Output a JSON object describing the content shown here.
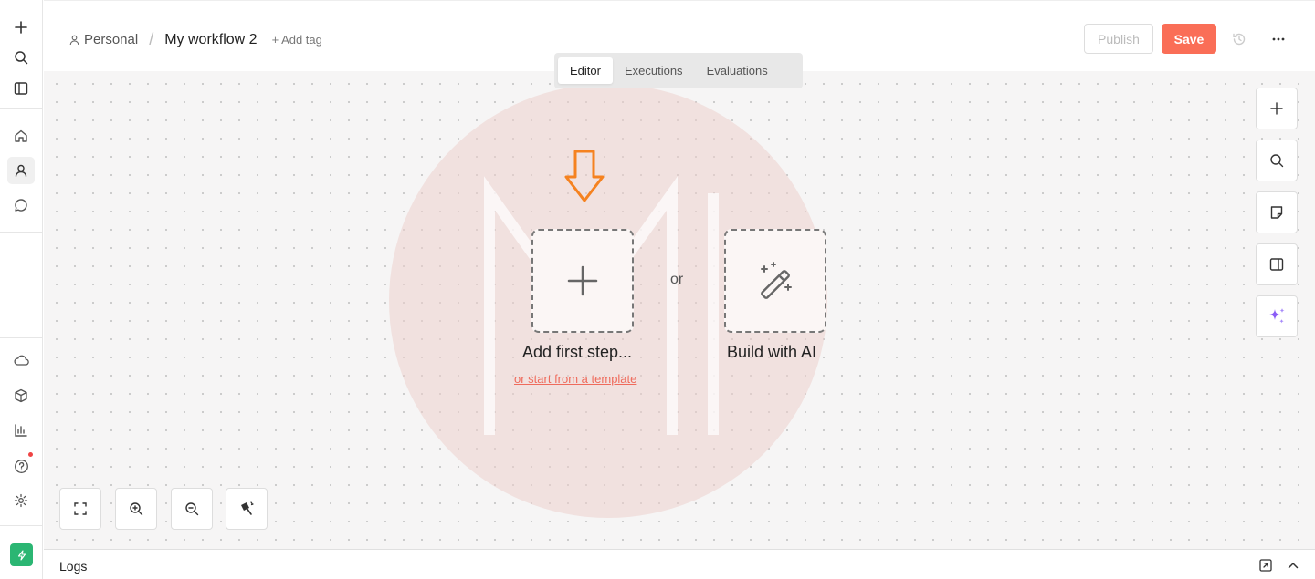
{
  "header": {
    "project": "Personal",
    "separator": "/",
    "workflow_name": "My workflow 2",
    "add_tag": "+ Add tag",
    "publish_label": "Publish",
    "save_label": "Save"
  },
  "tabs": [
    {
      "label": "Editor",
      "active": true
    },
    {
      "label": "Executions",
      "active": false
    },
    {
      "label": "Evaluations",
      "active": false
    }
  ],
  "canvas": {
    "add_first_step": "Add first step...",
    "or": "or",
    "build_with_ai": "Build with AI",
    "template_link": "or start from a template"
  },
  "logs": {
    "title": "Logs"
  },
  "colors": {
    "accent": "#fa6e57",
    "arrow": "#f58220",
    "ai_sparkle": "#8b5cf6",
    "logo": "#2bb673"
  },
  "icons": {
    "sidebar_top": [
      "plus-icon",
      "search-icon",
      "panel-icon"
    ],
    "sidebar_nav": [
      "home-icon",
      "user-icon",
      "chat-icon"
    ],
    "sidebar_bottom": [
      "cloud-icon",
      "box-icon",
      "chart-icon",
      "help-icon",
      "gear-icon"
    ],
    "right_toolbar": [
      "plus-icon",
      "search-icon",
      "sticky-note-icon",
      "panel-icon",
      "sparkle-icon"
    ],
    "zoom": [
      "fit-view-icon",
      "zoom-in-icon",
      "zoom-out-icon",
      "tidy-up-icon"
    ]
  }
}
